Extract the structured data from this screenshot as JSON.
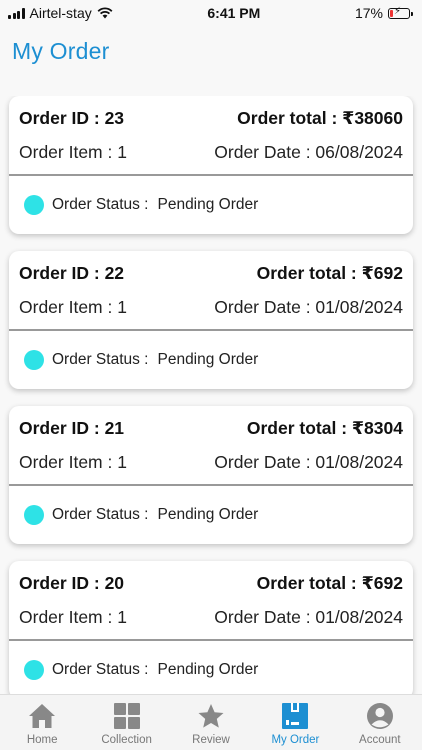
{
  "status_bar": {
    "carrier": "Airtel-stay",
    "time": "6:41 PM",
    "battery": "17%"
  },
  "page_title": "My Order",
  "orders": [
    {
      "id_label": "Order ID : 23",
      "total_label": "Order total : ₹38060",
      "item_label": "Order Item : 1",
      "date_label": "Order Date : 06/08/2024",
      "status_label": "Order Status :",
      "status_value": "Pending Order"
    },
    {
      "id_label": "Order ID : 22",
      "total_label": "Order total : ₹692",
      "item_label": "Order Item : 1",
      "date_label": "Order Date : 01/08/2024",
      "status_label": "Order Status :",
      "status_value": "Pending Order"
    },
    {
      "id_label": "Order ID : 21",
      "total_label": "Order total : ₹8304",
      "item_label": "Order Item : 1",
      "date_label": "Order Date : 01/08/2024",
      "status_label": "Order Status :",
      "status_value": "Pending Order"
    },
    {
      "id_label": "Order ID : 20",
      "total_label": "Order total : ₹692",
      "item_label": "Order Item : 1",
      "date_label": "Order Date : 01/08/2024",
      "status_label": "Order Status :",
      "status_value": "Pending Order"
    }
  ],
  "tabs": [
    {
      "label": "Home",
      "icon": "home-icon",
      "active": false
    },
    {
      "label": "Collection",
      "icon": "grid-icon",
      "active": false
    },
    {
      "label": "Review",
      "icon": "star-icon",
      "active": false
    },
    {
      "label": "My Order",
      "icon": "box-icon",
      "active": true
    },
    {
      "label": "Account",
      "icon": "user-icon",
      "active": false
    }
  ],
  "colors": {
    "accent": "#1d8fd2",
    "status_dot": "#2ee2e6",
    "inactive_tab": "#777777"
  }
}
